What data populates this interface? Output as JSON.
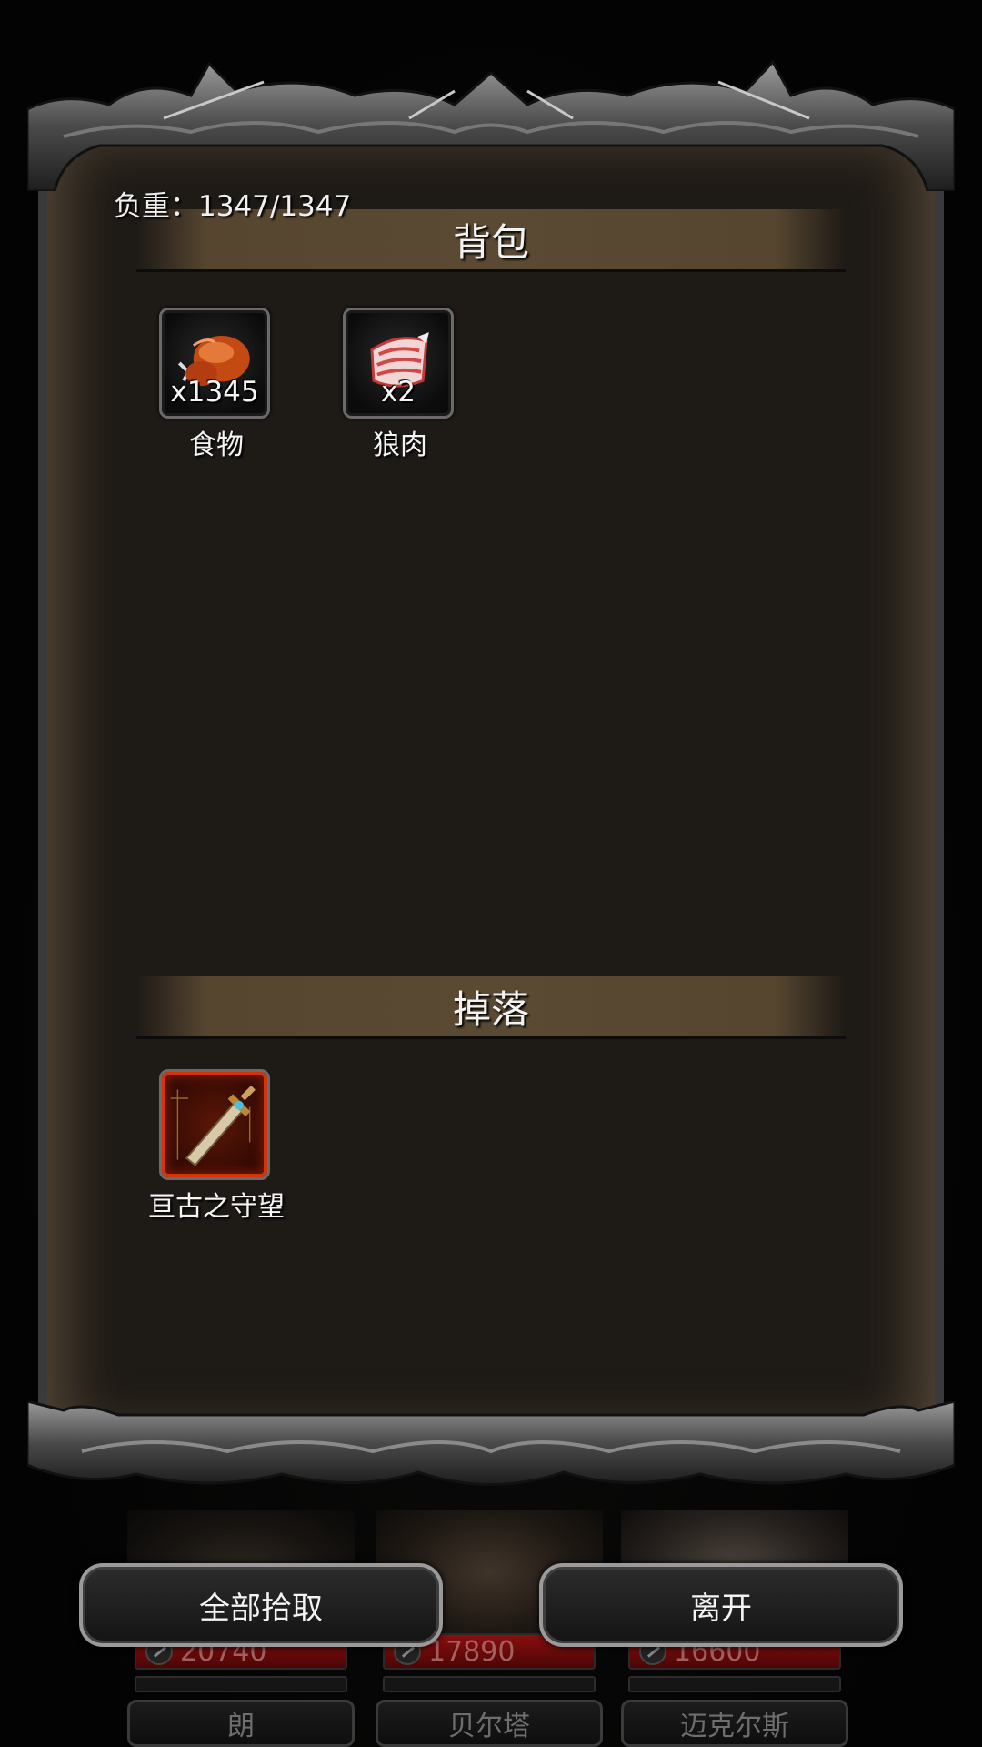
{
  "backpack": {
    "title": "背包",
    "weight_text": "负重：1347/1347",
    "items": [
      {
        "name": "食物",
        "quantity": "x1345",
        "icon": "roast-meat-icon"
      },
      {
        "name": "狼肉",
        "quantity": "x2",
        "icon": "raw-meat-icon"
      }
    ]
  },
  "drops": {
    "title": "掉落",
    "items": [
      {
        "name": "亘古之守望",
        "icon": "sword-icon",
        "rarity_color": "#d3340c"
      }
    ]
  },
  "actions": {
    "pickup_all": "全部拾取",
    "leave": "离开"
  },
  "party": [
    {
      "name": "朗",
      "hp": "20740"
    },
    {
      "name": "贝尔塔",
      "hp": "17890"
    },
    {
      "name": "迈克尔斯",
      "hp": "16600"
    }
  ]
}
